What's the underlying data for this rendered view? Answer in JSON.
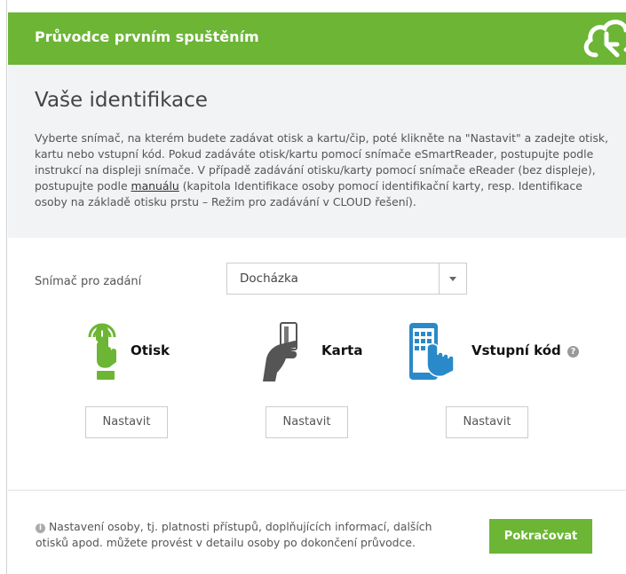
{
  "header": {
    "title": "Průvodce prvním spuštěním"
  },
  "intro": {
    "title": "Vaše identifikace",
    "text_before_link": "Vyberte snímač, na kterém budete zadávat otisk a kartu/čip, poté klikněte na \"Nastavit\" a zadejte otisk, kartu nebo vstupní kód. Pokud zadáváte otisk/kartu pomocí snímače eSmartReader, postupujte podle instrukcí na displeji snímače. V případě zadávání otisku/karty pomocí snímače eReader (bez displeje), postupujte podle ",
    "link_text": "manuálu",
    "text_after_link": " (kapitola Identifikace osoby pomocí identifikační karty, resp. Identifikace osoby na základě otisku prstu – Režim pro zadávání v CLOUD řešení)."
  },
  "reader_select": {
    "label": "Snímač pro zadání",
    "value": "Docházka"
  },
  "methods": [
    {
      "label": "Otisk",
      "button": "Nastavit"
    },
    {
      "label": "Karta",
      "button": "Nastavit"
    },
    {
      "label": "Vstupní kód",
      "button": "Nastavit"
    }
  ],
  "footer": {
    "note": "Nastavení osoby, tj. platnosti přístupů, doplňujících informací, dalších otisků apod. můžete provést v detailu osoby po dokončení průvodce.",
    "continue_label": "Pokračovat"
  },
  "colors": {
    "brand_green": "#6cb535",
    "intro_bg": "#f1f3f4",
    "icon_blue": "#2a8ac9",
    "icon_gray": "#555"
  }
}
